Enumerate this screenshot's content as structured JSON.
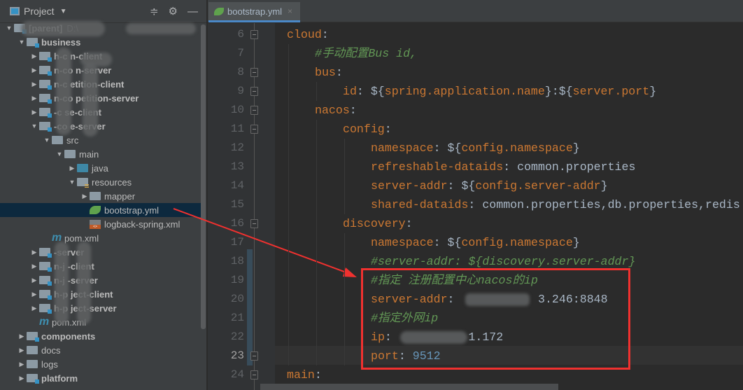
{
  "project_panel": {
    "title": "Project",
    "icons": [
      "collapse-all-icon",
      "gear-icon",
      "minimize-icon"
    ]
  },
  "tree": [
    {
      "label": "[parent]",
      "suffix": "D:\\",
      "level": 0,
      "arrow": "open",
      "icon": "folder-module",
      "bold": true
    },
    {
      "label": "business",
      "level": 1,
      "arrow": "open",
      "icon": "folder-module",
      "bold": true
    },
    {
      "label": "h-c      n-client",
      "level": 2,
      "arrow": "closed",
      "icon": "folder-module",
      "bold": true
    },
    {
      "label": "n-co      n-server",
      "level": 2,
      "arrow": "closed",
      "icon": "folder-module",
      "bold": true
    },
    {
      "label": "n-c      etition-client",
      "level": 2,
      "arrow": "closed",
      "icon": "folder-module",
      "bold": true
    },
    {
      "label": "n-co     petition-server",
      "level": 2,
      "arrow": "closed",
      "icon": "folder-module",
      "bold": true
    },
    {
      "label": "-c      se-client",
      "level": 2,
      "arrow": "closed",
      "icon": "folder-module",
      "bold": true
    },
    {
      "label": "-co     e-server",
      "level": 2,
      "arrow": "open",
      "icon": "folder-module",
      "bold": true
    },
    {
      "label": "src",
      "level": 3,
      "arrow": "open",
      "icon": "folder"
    },
    {
      "label": "main",
      "level": 4,
      "arrow": "open",
      "icon": "folder"
    },
    {
      "label": "java",
      "level": 5,
      "arrow": "closed",
      "icon": "folder-java"
    },
    {
      "label": "resources",
      "level": 5,
      "arrow": "open",
      "icon": "folder-resources"
    },
    {
      "label": "mapper",
      "level": 6,
      "arrow": "closed",
      "icon": "folder"
    },
    {
      "label": "bootstrap.yml",
      "level": 6,
      "arrow": "none",
      "icon": "spring-yml",
      "selected": true
    },
    {
      "label": "logback-spring.xml",
      "level": 6,
      "arrow": "none",
      "icon": "xml"
    },
    {
      "label": "pom.xml",
      "level": 3,
      "arrow": "none",
      "icon": "maven"
    },
    {
      "label": "-server",
      "level": 2,
      "arrow": "closed",
      "icon": "folder-module",
      "bold": true
    },
    {
      "label": "n-j   -client",
      "level": 2,
      "arrow": "closed",
      "icon": "folder-module",
      "bold": true
    },
    {
      "label": "n-j   -server",
      "level": 2,
      "arrow": "closed",
      "icon": "folder-module",
      "bold": true
    },
    {
      "label": "h-p   ject-client",
      "level": 2,
      "arrow": "closed",
      "icon": "folder-module",
      "bold": true
    },
    {
      "label": "h-p   ject-server",
      "level": 2,
      "arrow": "closed",
      "icon": "folder-module",
      "bold": true
    },
    {
      "label": "pom.xml",
      "level": 2,
      "arrow": "none",
      "icon": "maven"
    },
    {
      "label": "components",
      "level": 1,
      "arrow": "closed",
      "icon": "folder-module",
      "bold": true
    },
    {
      "label": "docs",
      "level": 1,
      "arrow": "closed",
      "icon": "folder"
    },
    {
      "label": "logs",
      "level": 1,
      "arrow": "closed",
      "icon": "folder"
    },
    {
      "label": "platform",
      "level": 1,
      "arrow": "closed",
      "icon": "folder-module",
      "bold": true
    }
  ],
  "editor": {
    "tab": {
      "label": "bootstrap.yml",
      "close": "×"
    },
    "current_line": 23,
    "lines": [
      {
        "n": 6,
        "indent": 0,
        "fold": true,
        "seg": [
          [
            "cloud",
            "k"
          ],
          [
            ":",
            "p"
          ]
        ]
      },
      {
        "n": 7,
        "indent": 1,
        "seg": [
          [
            "#手动配置Bus id,",
            "c"
          ]
        ]
      },
      {
        "n": 8,
        "indent": 1,
        "fold": true,
        "seg": [
          [
            "bus",
            "k"
          ],
          [
            ":",
            "p"
          ]
        ]
      },
      {
        "n": 9,
        "indent": 2,
        "fold": true,
        "seg": [
          [
            "id",
            "k"
          ],
          [
            ": ${",
            "p"
          ],
          [
            "spring.application.name",
            "i"
          ],
          [
            "}:${",
            "p"
          ],
          [
            "server.port",
            "i"
          ],
          [
            "}",
            "p"
          ]
        ]
      },
      {
        "n": 10,
        "indent": 1,
        "fold": true,
        "seg": [
          [
            "nacos",
            "k"
          ],
          [
            ":",
            "p"
          ]
        ]
      },
      {
        "n": 11,
        "indent": 2,
        "fold": true,
        "seg": [
          [
            "config",
            "k"
          ],
          [
            ":",
            "p"
          ]
        ]
      },
      {
        "n": 12,
        "indent": 3,
        "seg": [
          [
            "namespace",
            "k"
          ],
          [
            ": ${",
            "p"
          ],
          [
            "config.namespace",
            "i"
          ],
          [
            "}",
            "p"
          ]
        ]
      },
      {
        "n": 13,
        "indent": 3,
        "seg": [
          [
            "refreshable-dataids",
            "k"
          ],
          [
            ": ",
            "p"
          ],
          [
            "common.properties",
            "v"
          ]
        ]
      },
      {
        "n": 14,
        "indent": 3,
        "seg": [
          [
            "server-addr",
            "k"
          ],
          [
            ": ${",
            "p"
          ],
          [
            "config.server-addr",
            "i"
          ],
          [
            "}",
            "p"
          ]
        ]
      },
      {
        "n": 15,
        "indent": 3,
        "seg": [
          [
            "shared-dataids",
            "k"
          ],
          [
            ": ",
            "p"
          ],
          [
            "common.properties,db.properties,redis",
            "v"
          ]
        ]
      },
      {
        "n": 16,
        "indent": 2,
        "fold": true,
        "seg": [
          [
            "discovery",
            "k"
          ],
          [
            ":",
            "p"
          ]
        ]
      },
      {
        "n": 17,
        "indent": 3,
        "seg": [
          [
            "namespace",
            "k"
          ],
          [
            ": ${",
            "p"
          ],
          [
            "config.namespace",
            "i"
          ],
          [
            "}",
            "p"
          ]
        ]
      },
      {
        "n": 18,
        "indent": 3,
        "seg": [
          [
            "#server-addr: ${discovery.server-addr}",
            "c"
          ]
        ]
      },
      {
        "n": 19,
        "indent": 3,
        "seg": [
          [
            "#指定 注册配置中心nacos的ip",
            "c"
          ]
        ]
      },
      {
        "n": 20,
        "indent": 3,
        "seg": [
          [
            "server-addr",
            "k"
          ],
          [
            ": ",
            "p"
          ],
          [
            "           3.246:8848",
            "v"
          ]
        ]
      },
      {
        "n": 21,
        "indent": 3,
        "seg": [
          [
            "#指定外网ip",
            "c"
          ]
        ]
      },
      {
        "n": 22,
        "indent": 3,
        "seg": [
          [
            "ip",
            "k"
          ],
          [
            ": ",
            "p"
          ],
          [
            "          1.172",
            "v"
          ]
        ]
      },
      {
        "n": 23,
        "indent": 3,
        "fold": true,
        "seg": [
          [
            "port",
            "k"
          ],
          [
            ": ",
            "p"
          ],
          [
            "9512",
            "n"
          ]
        ]
      },
      {
        "n": 24,
        "indent": 0,
        "fold": true,
        "seg": [
          [
            "main",
            "k"
          ],
          [
            ":",
            "p"
          ]
        ]
      }
    ]
  },
  "colors": {
    "key": "#cc7832",
    "comment": "#629755",
    "number": "#6897bb",
    "value": "#a9b7c6",
    "annotation": "#f0312f"
  }
}
